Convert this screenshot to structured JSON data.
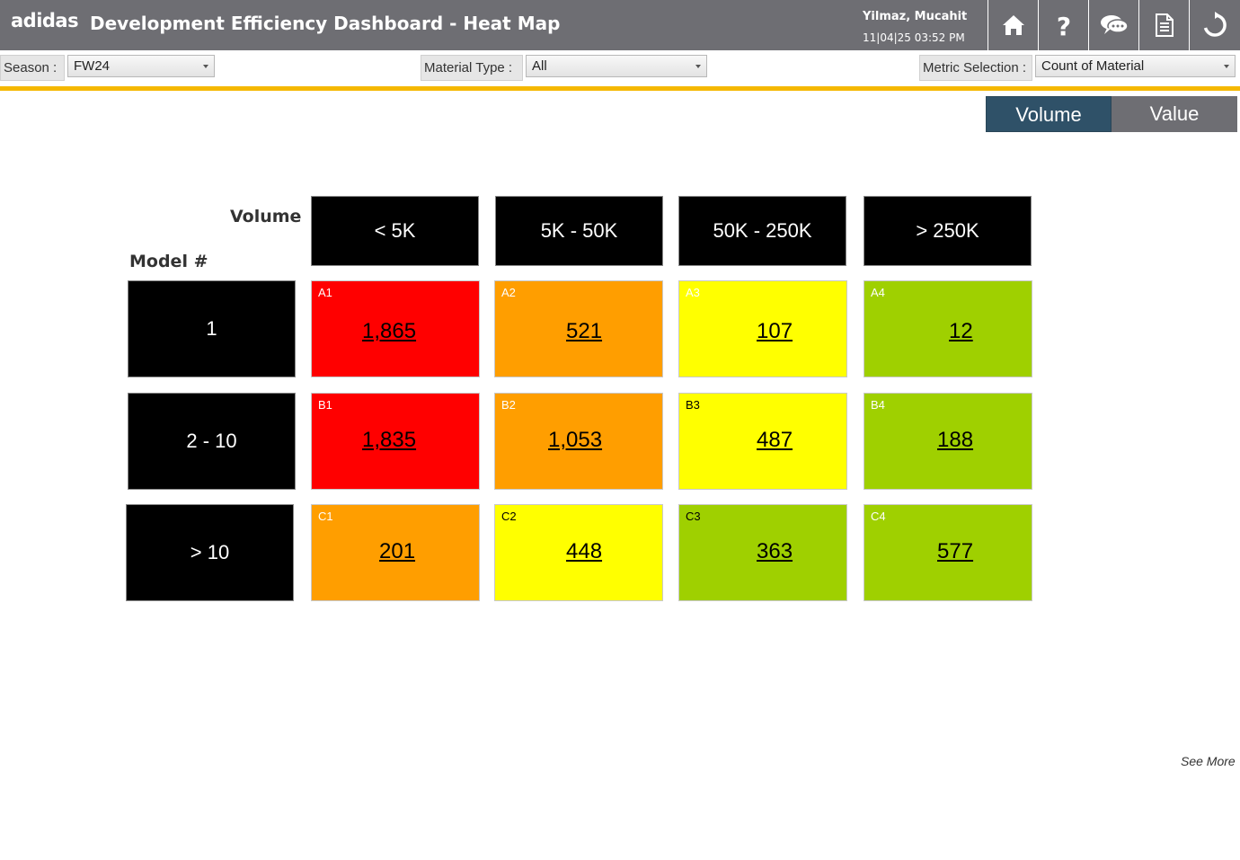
{
  "header": {
    "logo_text": "adidas",
    "title": "Development Efficiency Dashboard - Heat Map",
    "user_name": "Yilmaz, Mucahit",
    "datetime": "11|04|25 03:52 PM",
    "buttons": [
      "home-icon",
      "help-icon",
      "chat-icon",
      "document-icon",
      "refresh-icon"
    ],
    "bg_color": "#6e6e73"
  },
  "filters": {
    "season": {
      "label": "Season :",
      "value": "FW24"
    },
    "material_type": {
      "label": "Material Type :",
      "value": "All"
    },
    "metric": {
      "label": "Metric Selection :",
      "value": "Count of Material"
    }
  },
  "toggle": {
    "volume_label": "Volume",
    "value_label": "Value",
    "active": "Volume",
    "active_color": "#2f5168"
  },
  "heatmap": {
    "x_axis_label": "Volume",
    "y_axis_label": "Model #",
    "columns": [
      "< 5K",
      "5K - 50K",
      "50K - 250K",
      "> 250K"
    ],
    "rows": [
      {
        "label": "1",
        "cells": [
          {
            "code": "A1",
            "value": "1,865",
            "level": "red"
          },
          {
            "code": "A2",
            "value": "521",
            "level": "orange"
          },
          {
            "code": "A3",
            "value": "107",
            "level": "yellow"
          },
          {
            "code": "A4",
            "value": "12",
            "level": "green"
          }
        ]
      },
      {
        "label": "2 - 10",
        "cells": [
          {
            "code": "B1",
            "value": "1,835",
            "level": "red"
          },
          {
            "code": "B2",
            "value": "1,053",
            "level": "orange"
          },
          {
            "code": "B3",
            "value": "487",
            "level": "yellow"
          },
          {
            "code": "B4",
            "value": "188",
            "level": "green"
          }
        ]
      },
      {
        "label": "> 10",
        "cells": [
          {
            "code": "C1",
            "value": "201",
            "level": "orange"
          },
          {
            "code": "C2",
            "value": "448",
            "level": "yellow"
          },
          {
            "code": "C3",
            "value": "363",
            "level": "green"
          },
          {
            "code": "C4",
            "value": "577",
            "level": "green"
          }
        ]
      }
    ],
    "colors": {
      "red": "#ff0000",
      "orange": "#ff9e00",
      "yellow": "#ffff00",
      "green": "#9fd000"
    }
  },
  "footer": {
    "see_more": "See More"
  }
}
